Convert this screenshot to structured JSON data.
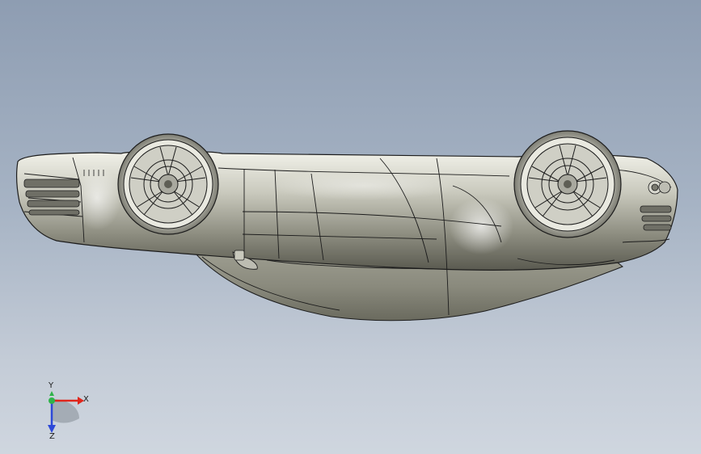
{
  "triad": {
    "x_label": "X",
    "y_label": "Y",
    "z_label": "Z"
  },
  "colors": {
    "background_top": "#8e9db2",
    "background_bottom": "#cfd6df",
    "body_light": "#dcdcd2",
    "body_dark": "#5b5b52",
    "edge": "#1c1c1c",
    "x_axis": "#e0261c",
    "y_axis": "#2fb34a",
    "z_axis": "#2d49d8"
  },
  "icons": [
    "car-model",
    "wheel-icon",
    "coordinate-triad-icon"
  ]
}
